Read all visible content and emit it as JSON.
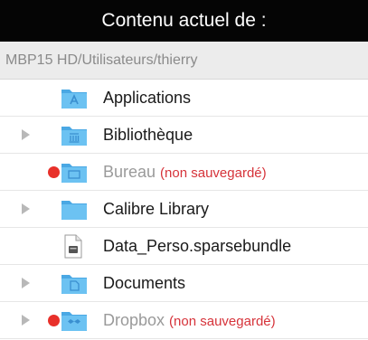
{
  "header": {
    "title": "Contenu actuel de :"
  },
  "path": {
    "text": "MBP15 HD/Utilisateurs/thierry"
  },
  "colors": {
    "folder": "#5ab8ee",
    "not_saved": "#d6333a",
    "header_bg": "#050505"
  },
  "items": [
    {
      "label": "Applications",
      "icon": "applications-folder-icon",
      "expandable": false,
      "excluded": false,
      "note": ""
    },
    {
      "label": "Bibliothèque",
      "icon": "library-folder-icon",
      "expandable": true,
      "excluded": false,
      "note": ""
    },
    {
      "label": "Bureau",
      "icon": "desktop-folder-icon",
      "expandable": false,
      "excluded": true,
      "note": "(non sauvegardé)"
    },
    {
      "label": "Calibre Library",
      "icon": "folder-icon",
      "expandable": true,
      "excluded": false,
      "note": ""
    },
    {
      "label": "Data_Perso.sparsebundle",
      "icon": "sparsebundle-file-icon",
      "expandable": false,
      "excluded": false,
      "note": ""
    },
    {
      "label": "Documents",
      "icon": "documents-folder-icon",
      "expandable": true,
      "excluded": false,
      "note": ""
    },
    {
      "label": "Dropbox",
      "icon": "dropbox-folder-icon",
      "expandable": true,
      "excluded": true,
      "note": "(non sauvegardé)"
    }
  ]
}
